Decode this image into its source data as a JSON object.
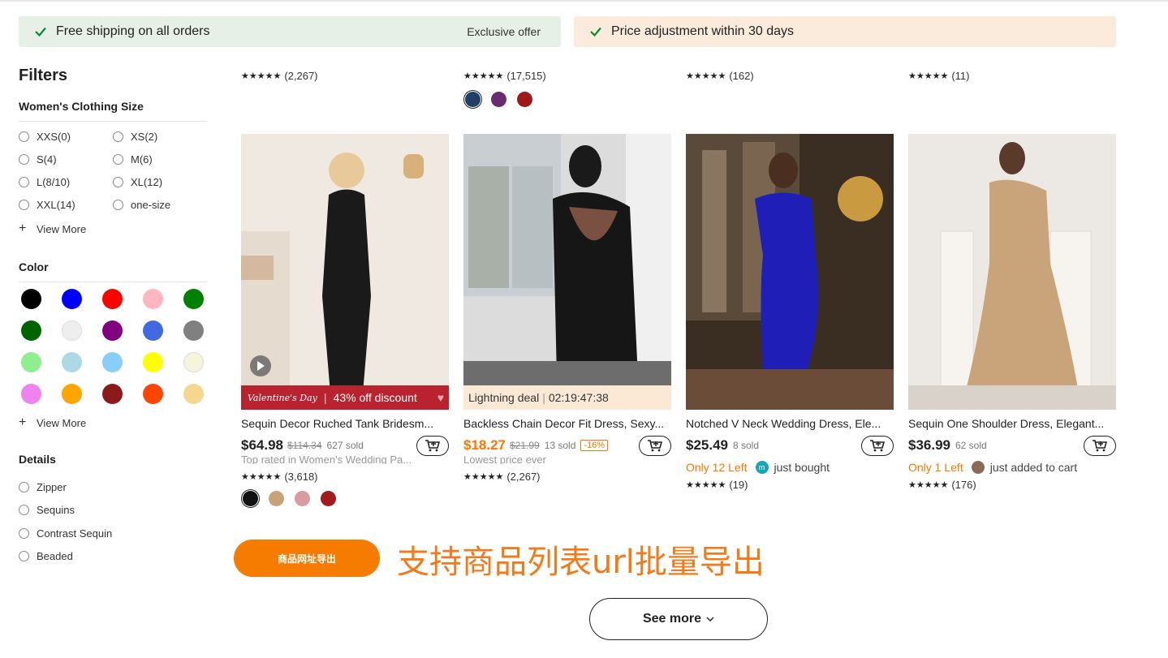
{
  "banners": {
    "shipping": "Free shipping on all orders",
    "exclusive": "Exclusive offer",
    "price_adjust": "Price adjustment within 30 days"
  },
  "sidebar": {
    "title": "Filters",
    "size": {
      "title": "Women's Clothing Size",
      "options": [
        "XXS(0)",
        "XS(2)",
        "S(4)",
        "M(6)",
        "L(8/10)",
        "XL(12)",
        "XXL(14)",
        "one-size"
      ],
      "view_more": "View More"
    },
    "color": {
      "title": "Color",
      "swatches": [
        "#000000",
        "#0000ff",
        "#ff0000",
        "#ffb6c1",
        "#008000",
        "#006400",
        "#eeeeee",
        "#800080",
        "#4169e1",
        "#808080",
        "#90ee90",
        "#add8e6",
        "#87cefa",
        "#ffff00",
        "#f5f5dc",
        "#ee82ee",
        "#ffa500",
        "#8b1a1a",
        "#ff4500",
        "#f5d78e"
      ],
      "view_more": "View More"
    },
    "details": {
      "title": "Details",
      "options": [
        "Zipper",
        "Sequins",
        "Contrast Sequin",
        "Beaded"
      ]
    }
  },
  "top_row_ratings": [
    {
      "count": "(2,267)"
    },
    {
      "count": "(17,515)"
    },
    {
      "count": "(162)"
    },
    {
      "count": "(11)"
    }
  ],
  "top_patterns": [
    "#1f3f66",
    "#6a2c70",
    "#a0191a"
  ],
  "products": [
    {
      "title": "Sequin Decor Ruched Tank Bridesm...",
      "price": "$64.98",
      "original": "$114.34",
      "sold": "627 sold",
      "strip_brand": "Valentine's Day",
      "strip_text": "43% off discount",
      "cut_text": "Top rated in Women's Wedding Pa...",
      "rating": "(3,618)",
      "patterns": [
        "#111111",
        "#c9a27a",
        "#d99aa0",
        "#a31b1b"
      ]
    },
    {
      "title": "Backless Chain Decor Fit Dress, Sexy...",
      "price": "$18.27",
      "original": "$21.99",
      "sold": "13 sold",
      "discount": "-16%",
      "strip_text": "Lightning deal",
      "strip_timer": "02:19:47:38",
      "cut_text": "Lowest price ever",
      "rating": "(2,267)"
    },
    {
      "title": "Notched V Neck Wedding Dress, Ele...",
      "price": "$25.49",
      "sold": "8 sold",
      "stock": "Only 12 Left",
      "activity": "just bought",
      "avatar_letter": "m",
      "rating": "(19)"
    },
    {
      "title": "Sequin One Shoulder Dress, Elegant...",
      "price": "$36.99",
      "sold": "62 sold",
      "stock": "Only 1 Left",
      "activity": "just added to cart",
      "rating": "(176)"
    }
  ],
  "export": {
    "button": "商品网址导出",
    "caption": "支持商品列表url批量导出"
  },
  "see_more": "See more"
}
